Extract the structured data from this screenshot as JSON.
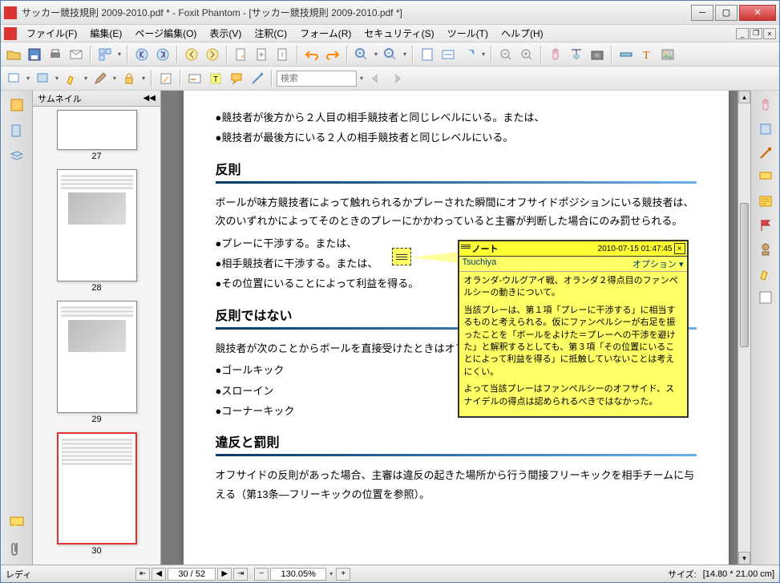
{
  "window": {
    "title": "サッカー競技規則 2009-2010.pdf * - Foxit Phantom - [サッカー競技規則 2009-2010.pdf *]"
  },
  "menu": {
    "file": "ファイル(F)",
    "edit": "編集(E)",
    "pageedit": "ページ編集(O)",
    "view": "表示(V)",
    "annot": "注釈(C)",
    "form": "フォーム(R)",
    "security": "セキュリティ(S)",
    "tools": "ツール(T)",
    "help": "ヘルプ(H)"
  },
  "search": {
    "placeholder": "検索"
  },
  "thumbnails": {
    "title": "サムネイル",
    "pages": [
      "27",
      "28",
      "29",
      "30"
    ],
    "selected": 3
  },
  "document": {
    "line1": "●競技者が後方から２人目の相手競技者と同じレベルにいる。または、",
    "line2": "●競技者が最後方にいる２人の相手競技者と同じレベルにいる。",
    "h1": "反則",
    "p1": "ボールが味方競技者によって触れられるかプレーされた瞬間にオフサイドポジションにいる競技者は、次のいずれかによってそのときのプレーにかかわっていると主審が判断した場合にのみ罰せられる。",
    "b1": "●プレーに干渉する。または、",
    "b2": "●相手競技者に干渉する。または、",
    "b3": "●その位置にいることによって利益を得る。",
    "h2": "反則ではない",
    "p2": "競技者が次のことからボールを直接受けたときはオフ",
    "b4": "●ゴールキック",
    "b5": "●スローイン",
    "b6": "●コーナーキック",
    "h3": "違反と罰則",
    "p3": "オフサイドの反則があった場合、主審は違反の起きた場所から行う間接フリーキックを相手チームに与える（第13条―フリーキックの位置を参照）。"
  },
  "note": {
    "title": "ノート",
    "date": "2010-07-15 01:47:45",
    "author": "Tsuchiya",
    "option": "オプション",
    "body1": "オランダ-ウルグアイ戦、オランダ２得点目のファンペルシーの動きについて。",
    "body2": "当該プレーは、第１項「プレーに干渉する」に相当するものと考えられる。仮にファンペルシーが右足を振ったことを「ボールをよけた＝プレーへの干渉を避けた」と解釈するとしても、第３項「その位置にいることによって利益を得る」に抵触していないことは考えにくい。",
    "body3": "よって当該プレーはファンペルシーのオフサイド、スナイデルの得点は認められるべきではなかった。"
  },
  "status": {
    "ready": "レディ",
    "page": "30 / 52",
    "zoom": "130.05%",
    "size_label": "サイズ:",
    "size": "[14.80 * 21.00 cm]"
  }
}
